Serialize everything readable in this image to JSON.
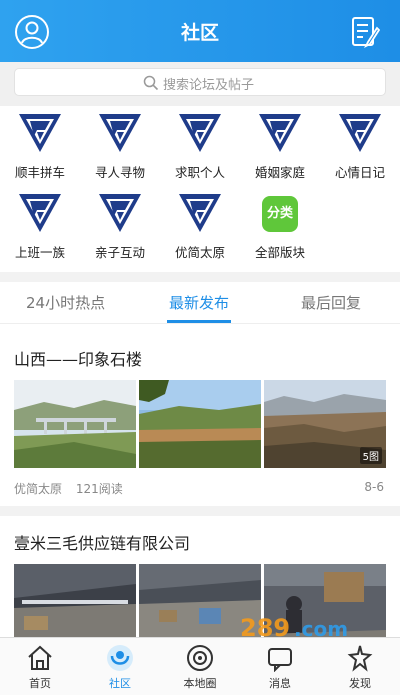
{
  "header": {
    "title": "社区"
  },
  "search": {
    "placeholder": "搜索论坛及帖子"
  },
  "categories": [
    {
      "label": "顺丰拼车",
      "icon": "v-shield-icon"
    },
    {
      "label": "寻人寻物",
      "icon": "v-shield-icon"
    },
    {
      "label": "求职个人",
      "icon": "v-shield-icon"
    },
    {
      "label": "婚姻家庭",
      "icon": "v-shield-icon"
    },
    {
      "label": "心情日记",
      "icon": "v-shield-icon"
    },
    {
      "label": "上班一族",
      "icon": "v-shield-icon"
    },
    {
      "label": "亲子互动",
      "icon": "v-shield-icon"
    },
    {
      "label": "优简太原",
      "icon": "v-shield-icon"
    },
    {
      "label": "全部版块",
      "icon": "category-badge-icon",
      "badge": "分类"
    }
  ],
  "tabs": [
    {
      "label": "24小时热点",
      "active": false
    },
    {
      "label": "最新发布",
      "active": true
    },
    {
      "label": "最后回复",
      "active": false
    }
  ],
  "posts": [
    {
      "title": "山西——印象石楼",
      "photo_count": "5图",
      "board": "优简太原",
      "reads": "121阅读",
      "date": "8-6"
    },
    {
      "title": "壹米三毛供应链有限公司"
    }
  ],
  "bottom_nav": [
    {
      "label": "首页",
      "icon": "home-icon",
      "active": false
    },
    {
      "label": "社区",
      "icon": "community-icon",
      "active": true
    },
    {
      "label": "本地圈",
      "icon": "local-circle-icon",
      "active": false
    },
    {
      "label": "消息",
      "icon": "message-icon",
      "active": false
    },
    {
      "label": "发现",
      "icon": "discover-icon",
      "active": false
    }
  ],
  "watermark": {
    "text": "289.com",
    "subtext": "手游网"
  },
  "colors": {
    "brand_blue": "#1e8ee6",
    "logo_navy": "#1f3c8a",
    "badge_green": "#5fc73a"
  }
}
